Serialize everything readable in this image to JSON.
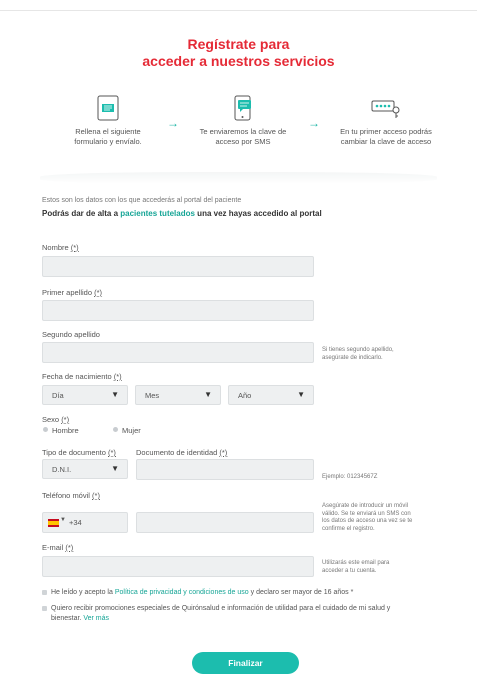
{
  "header": {
    "title_line1": "Regístrate para",
    "title_line2": "acceder a nuestros servicios"
  },
  "steps": [
    {
      "icon": "form-icon",
      "line1": "Rellena el siguiente",
      "line2": "formulario y envíalo."
    },
    {
      "icon": "sms-phone-icon",
      "line1": "Te enviaremos la clave de",
      "line2": "acceso por SMS"
    },
    {
      "icon": "password-key-icon",
      "line1": "En tu primer acceso podrás",
      "line2": "cambiar la clave de acceso"
    }
  ],
  "arrow_glyph": "→",
  "intro": {
    "line1": "Estos son los datos con los que accederás al portal del paciente",
    "line2_pre": "Podrás dar de alta a ",
    "line2_link": "pacientes tutelados",
    "line2_post": " una vez hayas accedido al portal"
  },
  "required_marker": "(*)",
  "form": {
    "nombre": {
      "label": "Nombre ",
      "value": ""
    },
    "apellido1": {
      "label": "Primer apellido ",
      "value": ""
    },
    "apellido2": {
      "label": "Segundo apellido",
      "value": "",
      "hint_line1": "Si tienes segundo apellido,",
      "hint_line2": "asegúrate de indicarlo."
    },
    "nacimiento": {
      "label": "Fecha de nacimiento ",
      "day": "Día",
      "month": "Mes",
      "year": "Año"
    },
    "sexo": {
      "label": "Sexo ",
      "options": [
        "Hombre",
        "Mujer"
      ]
    },
    "tipo_documento": {
      "label": "Tipo de documento ",
      "value": "D.N.I."
    },
    "documento": {
      "label": "Documento de identidad ",
      "value": "",
      "hint": "Ejemplo: 01234567Z"
    },
    "telefono": {
      "label": "Teléfono móvil ",
      "prefix": "+34",
      "value": "",
      "hint_lines": [
        "Asegúrate de introducir un móvil",
        "válido. Se te enviará un SMS con",
        "los datos de acceso una vez se te",
        "confirme el registro."
      ]
    },
    "email": {
      "label": "E-mail ",
      "value": "",
      "hint_line1": "Utilizarás este email para",
      "hint_line2": "acceder a tu cuenta."
    }
  },
  "caret_glyph": "▼",
  "consents": {
    "privacy_pre": "He leído y acepto la ",
    "privacy_link": "Política de privacidad y condiciones de uso",
    "privacy_post": " y declaro ser mayor de 16 años *",
    "promo_line1": "Quiero recibir promociones especiales de Quirónsalud e información de utilidad para el cuidado de mi salud y",
    "promo_line2": "bienestar. ",
    "promo_link": "Ver más"
  },
  "submit_label": "Finalizar",
  "colors": {
    "title": "#e52a36",
    "accent": "#1cbdae",
    "link": "#16a596"
  }
}
